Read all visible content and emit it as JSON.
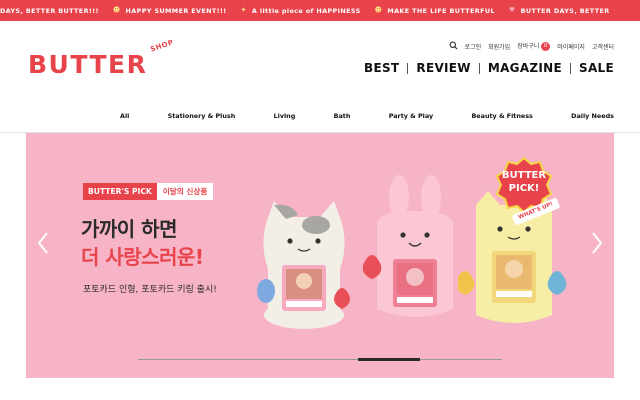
{
  "ticker": {
    "items": [
      {
        "icon": "none",
        "text": "R DAYS, BETTER BUTTER!!!"
      },
      {
        "icon": "smile-icon",
        "text": "HAPPY SUMMER EVENT!!!"
      },
      {
        "icon": "sparkle-icon",
        "text": "A little piece of HAPPINESS"
      },
      {
        "icon": "smile-icon",
        "text": "MAKE THE LIFE BUTTERFUL"
      },
      {
        "icon": "heart-icon",
        "text": "BUTTER DAYS, BETTER"
      }
    ]
  },
  "header": {
    "logo": {
      "text": "BUTTER",
      "badge": "SHOP"
    },
    "util": {
      "login": "로그인",
      "join": "회원가입",
      "cart": "장바구니",
      "cart_count": "0",
      "mypage": "마이페이지",
      "support": "고객센터"
    },
    "mainnav": [
      "BEST",
      "REVIEW",
      "MAGAZINE",
      "SALE"
    ]
  },
  "catnav": [
    "All",
    "Stationery & Plush",
    "Living",
    "Bath",
    "Party & Play",
    "Beauty & Fitness",
    "Daily Needs"
  ],
  "banner": {
    "tag_red": "BUTTER'S PICK",
    "tag_white": "이달의 신상품",
    "headline1": "가까이 하면",
    "headline2": "더 사랑스러운!",
    "subline": "포토카드 인형, 포토카드 키링 출시!",
    "badge": {
      "line1": "BUTTER",
      "line2": "PICK!",
      "ribbon": "WHAT'S UP!"
    },
    "slide_progress": 0.69,
    "colors": {
      "background": "#f7b4c6",
      "accent": "#e8434a"
    }
  },
  "colors": {
    "brand": "#e8434a"
  }
}
